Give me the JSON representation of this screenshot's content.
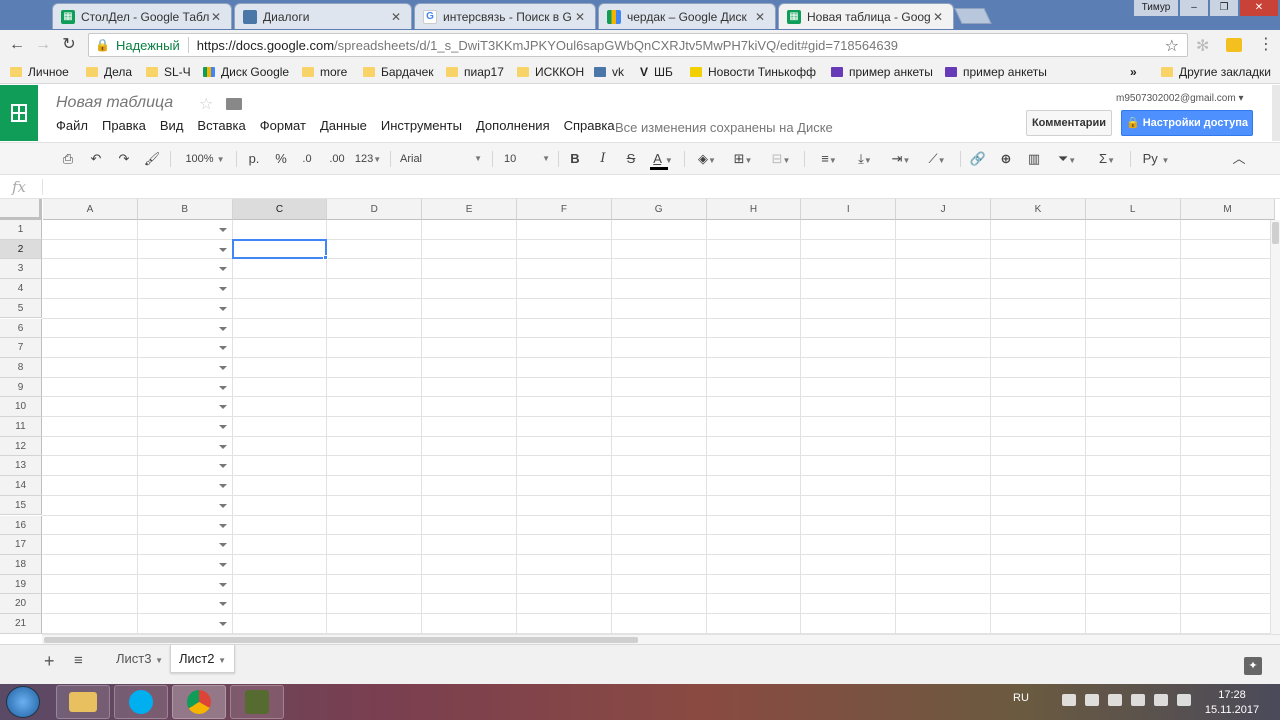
{
  "browser": {
    "tabs": [
      {
        "title": "СтолДел - Google Табли",
        "icon": "sheets-icon",
        "active": false
      },
      {
        "title": "Диалоги",
        "icon": "chat-icon",
        "active": false
      },
      {
        "title": "интерсвязь - Поиск в G",
        "icon": "google-icon",
        "active": false
      },
      {
        "title": "чердак – Google Диск",
        "icon": "drive-icon",
        "active": false
      },
      {
        "title": "Новая таблица - Googl",
        "icon": "sheets-icon",
        "active": true
      }
    ],
    "close_glyph": "✕",
    "window_user": "Тимур",
    "secure_label": "Надежный",
    "url_host": "https://docs.google.com",
    "url_path": "/spreadsheets/d/1_s_DwiT3KKmJPKYOul6sapGWbQnCXRJtv5MwPH7kiVQ/edit#gid=718564639",
    "bookmarks": [
      {
        "label": "Личное",
        "icon": "folder-icon"
      },
      {
        "label": "Дела",
        "icon": "folder-icon"
      },
      {
        "label": "SL-Ч",
        "icon": "folder-icon"
      },
      {
        "label": "Диск Google",
        "icon": "drive-icon"
      },
      {
        "label": "more",
        "icon": "folder-icon"
      },
      {
        "label": "Бардачек",
        "icon": "folder-icon"
      },
      {
        "label": "пиар17",
        "icon": "folder-icon"
      },
      {
        "label": "ИСККОН",
        "icon": "folder-icon"
      },
      {
        "label": "vk",
        "icon": "vk-icon"
      },
      {
        "label": "ШБ",
        "icon": "v-icon"
      },
      {
        "label": "Новости Тинькофф",
        "icon": "bank-icon"
      },
      {
        "label": "пример анкеты",
        "icon": "form-icon"
      },
      {
        "label": "пример анкеты",
        "icon": "form-icon"
      }
    ],
    "bookmarks_more": "»",
    "other_bookmarks": "Другие закладки"
  },
  "doc": {
    "title": "Новая таблица",
    "account": "m9507302002@gmail.com",
    "menu": [
      "Файл",
      "Правка",
      "Вид",
      "Вставка",
      "Формат",
      "Данные",
      "Инструменты",
      "Дополнения",
      "Справка"
    ],
    "save_status": "Все изменения сохранены на Диске",
    "comments_label": "Комментарии",
    "share_label": "Настройки доступа"
  },
  "toolbar": {
    "zoom": "100%",
    "currency": "р.",
    "percent": "%",
    "decrease_decimals": ".0",
    "increase_decimals": ".00",
    "more_formats": "123",
    "font": "Arial",
    "font_size": "10",
    "bold": "B",
    "italic": "I",
    "strike": "S",
    "text_color": "A",
    "input_tools": "Ру",
    "text_color_bar": "#000000"
  },
  "formula_bar": {
    "label": "fx",
    "value": ""
  },
  "grid": {
    "columns": [
      "A",
      "B",
      "C",
      "D",
      "E",
      "F",
      "G",
      "H",
      "I",
      "J",
      "K",
      "L",
      "M"
    ],
    "rows": [
      "1",
      "2",
      "3",
      "4",
      "5",
      "6",
      "7",
      "8",
      "9",
      "10",
      "11",
      "12",
      "13",
      "14",
      "15",
      "16",
      "17",
      "18",
      "19",
      "20",
      "21"
    ],
    "selected_cell": "C2",
    "selection_color": "#4285f4"
  },
  "sheets": [
    {
      "name": "Лист3",
      "active": false
    },
    {
      "name": "Лист2",
      "active": true
    }
  ],
  "taskbar": {
    "language": "RU",
    "time": "17:28",
    "date": "15.11.2017"
  },
  "colors": {
    "sheets_green": "#0f9d58",
    "share_blue": "#4d90fe",
    "secure_green": "#0b8043"
  }
}
